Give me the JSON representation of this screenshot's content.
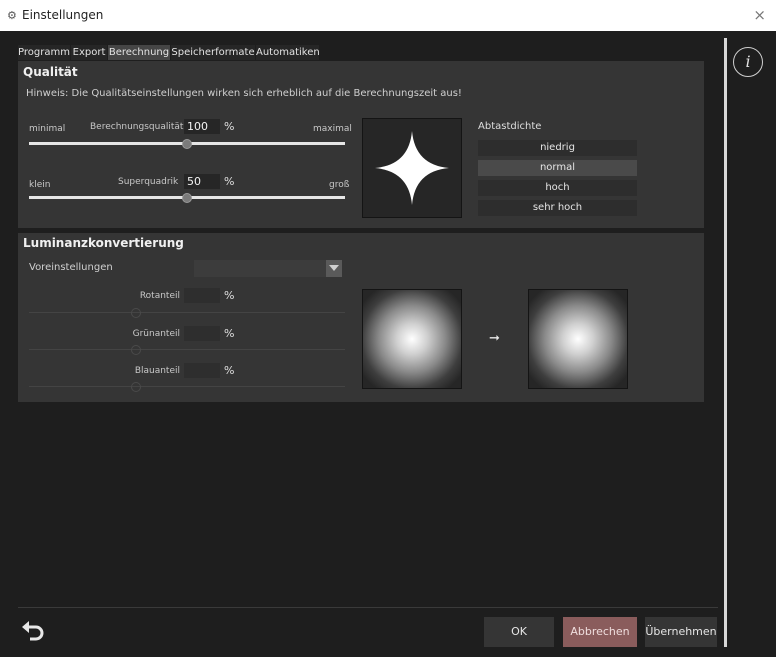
{
  "window": {
    "title": "Einstellungen",
    "close_glyph": "×",
    "app_icon": "settings-gears-icon"
  },
  "tabs": [
    "Programm",
    "Export",
    "Berechnung",
    "Speicherformate",
    "Automatiken"
  ],
  "active_tab": "Berechnung",
  "info_glyph": "i",
  "qualitaet": {
    "title": "Qualität",
    "hint": "Hinweis: Die Qualitätseinstellungen wirken sich erheblich auf die Berechnungszeit aus!",
    "berechnung": {
      "min_label": "minimal",
      "label": "Berechnungsqualität",
      "value": "100",
      "unit": "%",
      "max_label": "maximal",
      "level": 0.5
    },
    "superquadrik": {
      "min_label": "klein",
      "label": "Superquadrik",
      "value": "50",
      "unit": "%",
      "max_label": "groß",
      "level": 0.5
    },
    "abtastdichte": {
      "title": "Abtastdichte",
      "options": [
        "niedrig",
        "normal",
        "hoch",
        "sehr hoch"
      ],
      "selected": "normal"
    }
  },
  "luminanz": {
    "title": "Luminanzkonvertierung",
    "voreinstellungen_label": "Voreinstellungen",
    "rot": {
      "label": "Rotanteil",
      "unit": "%"
    },
    "gruen": {
      "label": "Grünanteil",
      "unit": "%"
    },
    "blau": {
      "label": "Blauanteil",
      "unit": "%"
    },
    "arrow": "➞"
  },
  "buttons": {
    "ok": "OK",
    "cancel": "Abbrechen",
    "apply": "Übernehmen"
  },
  "colors": {
    "cancel_button": "#8a5c5c",
    "selected_option": "#4a4a4a",
    "background": "#1e1e1e",
    "panel": "#353535"
  }
}
